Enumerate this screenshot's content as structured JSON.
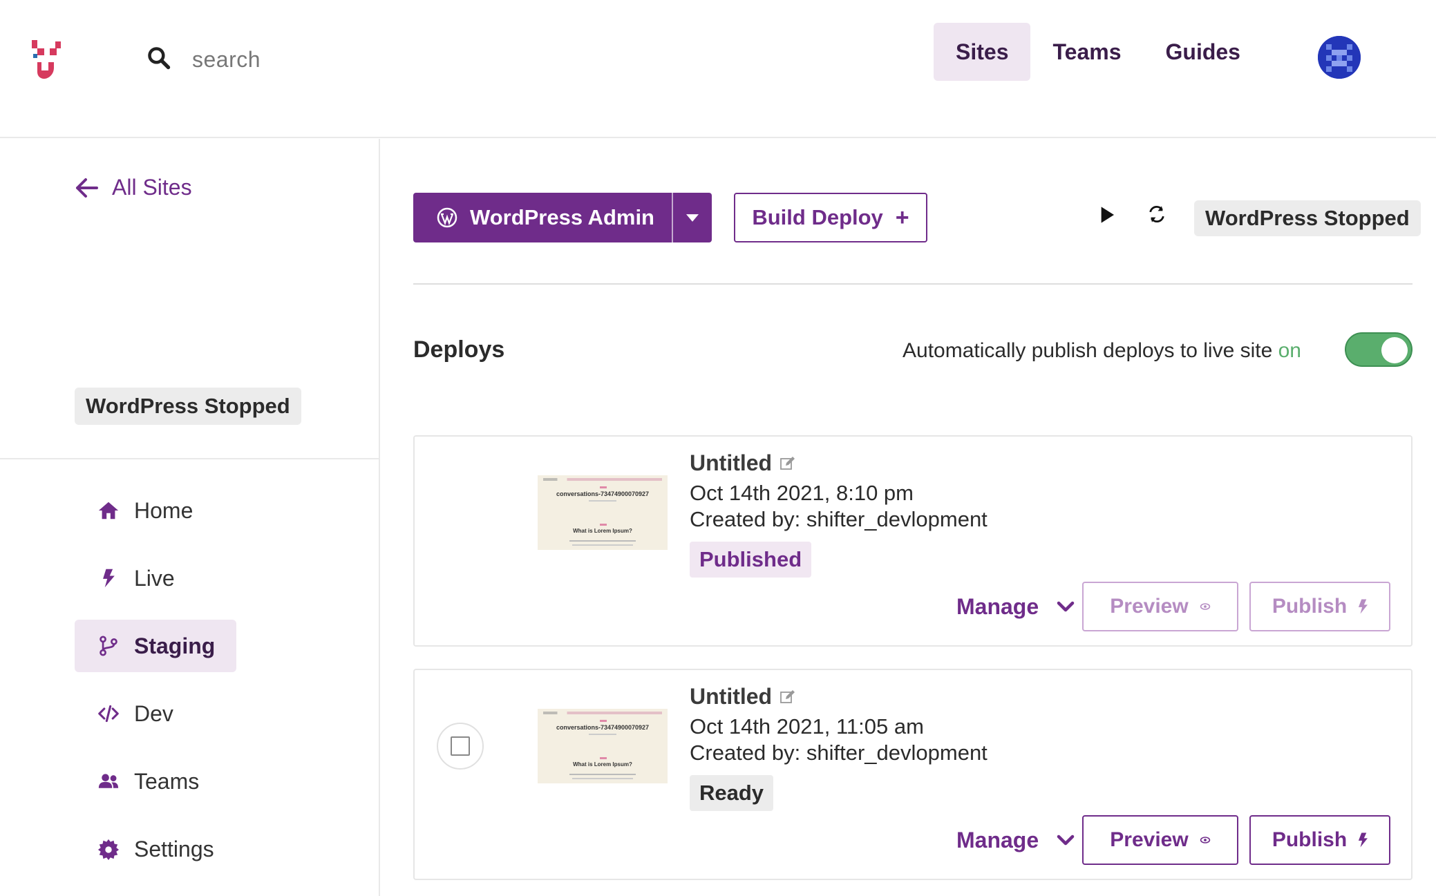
{
  "header": {
    "logo": "shifter-logo",
    "search": {
      "placeholder": "search",
      "icon": "search-icon"
    },
    "nav": [
      {
        "label": "Sites",
        "active": true
      },
      {
        "label": "Teams",
        "active": false
      },
      {
        "label": "Guides",
        "active": false
      }
    ],
    "avatar": "user-avatar"
  },
  "sidebar": {
    "back_label": "All Sites",
    "site_status": "WordPress Stopped",
    "menu": [
      {
        "label": "Home",
        "icon": "home-icon",
        "active": false
      },
      {
        "label": "Live",
        "icon": "bolt-icon",
        "active": false
      },
      {
        "label": "Staging",
        "icon": "branch-icon",
        "active": true
      },
      {
        "label": "Dev",
        "icon": "code-icon",
        "active": false
      },
      {
        "label": "Teams",
        "icon": "users-icon",
        "active": false
      },
      {
        "label": "Settings",
        "icon": "gear-icon",
        "active": false
      }
    ]
  },
  "toolbar": {
    "wp_admin_label": "WordPress Admin",
    "build_deploy_label": "Build Deploy",
    "build_deploy_plus": "+",
    "status": "WordPress Stopped"
  },
  "deploys": {
    "title": "Deploys",
    "auto_publish_text": "Automatically publish deploys to live site",
    "auto_publish_state": "on",
    "auto_publish_enabled": true,
    "items": [
      {
        "title": "Untitled",
        "date": "Oct 14th 2021, 8:10 pm",
        "created_by": "Created by: shifter_devlopment",
        "status": "Published",
        "thumb_title": "conversations-73474900070927",
        "thumb_question": "What is Lorem Ipsum?",
        "manage_label": "Manage",
        "preview_label": "Preview",
        "publish_label": "Publish",
        "selectable": false
      },
      {
        "title": "Untitled",
        "date": "Oct 14th 2021, 11:05 am",
        "created_by": "Created by: shifter_devlopment",
        "status": "Ready",
        "thumb_title": "conversations-73474900070927",
        "thumb_question": "What is Lorem Ipsum?",
        "manage_label": "Manage",
        "preview_label": "Preview",
        "publish_label": "Publish",
        "selectable": true
      }
    ]
  },
  "colors": {
    "accent": "#6f2c8a",
    "accent_light": "#f1e7f2",
    "toggle_on": "#5aae6d"
  }
}
